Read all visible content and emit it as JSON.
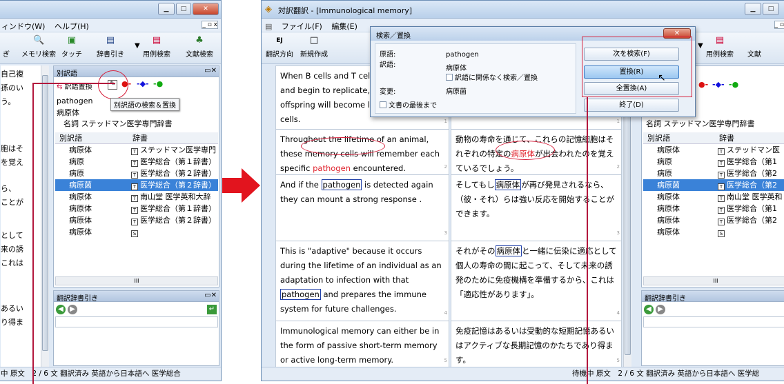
{
  "left_window": {
    "menu": [
      "ィンドウ(W)",
      "ヘルプ(H)"
    ],
    "toolbar": [
      "ぎ",
      "メモリ検索",
      "タッチ",
      "辞書引き",
      "用例検索",
      "文献検索"
    ],
    "left_text": [
      "自己複",
      "孫のい",
      "う。",
      "胞はそ",
      "を覚え",
      "ら、",
      "ことが",
      "として",
      "来の誘",
      "これは",
      "あるい",
      "り得ま"
    ],
    "alt_pane": {
      "title": "別訳語",
      "replace_btn": "訳語置換",
      "tooltip": "別訳語の検索＆置換",
      "source_word": "pathogen",
      "target_word": "病原体",
      "pos_line": "名詞 ステッドマン医学専門辞書",
      "headers": [
        "別訳語",
        "辞書"
      ],
      "rows": [
        {
          "term": "病原体",
          "dict": "ステッドマン医学専門"
        },
        {
          "term": "病原",
          "dict": "医学総合（第１辞書）"
        },
        {
          "term": "病原",
          "dict": "医学総合（第２辞書）"
        },
        {
          "term": "病原菌",
          "dict": "医学総合（第２辞書）",
          "selected": true
        },
        {
          "term": "病原体",
          "dict": "南山堂 医学英和大辞"
        },
        {
          "term": "病原体",
          "dict": "医学総合（第１辞書）"
        },
        {
          "term": "病原体",
          "dict": "医学総合（第２辞書）"
        },
        {
          "term": "病原体",
          "dict": ""
        }
      ],
      "scroll_label": "III"
    },
    "dict_pane_title": "翻訳辞書引き",
    "status": "中 原文　2 / 6 文 翻訳済み 英語から日本語へ 医学総合"
  },
  "main_window": {
    "title": "対訳翻訳 - [Immunological memory]",
    "menu": [
      "ファイル(F)",
      "編集(E)"
    ],
    "toolbar": [
      {
        "icon": "EJ",
        "label": "翻訳方向"
      },
      {
        "icon": "□",
        "label": "新規作成"
      }
    ],
    "toolbar_right": [
      "き",
      "用例検索",
      "文献"
    ],
    "english": [
      {
        "a": "When B cells and T cells",
        "b": "and begin to replicate,",
        "c": "offspring will become lo",
        "d": "cells."
      },
      {
        "lines": [
          "Throughout the lifetime of an animal,",
          "these memory cells will remember each"
        ],
        "pre": "specific ",
        "word": "pathogen",
        "post": " encountered."
      },
      {
        "pre": "And if the ",
        "word": "pathogen",
        "post": " is detected again",
        "line2": "they can mount a strong response ."
      },
      {
        "lines": [
          "This is \"adaptive\" because it occurs",
          "during the lifetime of an individual as an",
          "adaptation to infection with that"
        ],
        "word": "pathogen",
        "post": " and prepares the immune",
        "line5": "system for future challenges."
      },
      {
        "lines": [
          "Immunological memory can either be in",
          "the form of passive short-term memory",
          "or active long-term memory."
        ]
      }
    ],
    "japanese": [
      {
        "pre": "動物の寿命を通じて、これらの記憶細胞はそ",
        "l2pre": "れぞれの特定の",
        "word": "病原体",
        "l2post": "が出会われたのを覚え",
        "l3": "ているでしょう。"
      },
      {
        "pre": "そしてもし",
        "word": "病原体",
        "post": "が再び発見されるなら、",
        "l2": "（彼・それ）らは強い反応を開始することが",
        "l3": "できます。"
      },
      {
        "pre": "それがその",
        "word": "病原体",
        "post": "と一緒に伝染に適応として",
        "l2": "個人の寿命の間に起こって、そして未来の誘",
        "l3": "発のために免疫機構を準備するから、これは",
        "l4": "「適応性があります」。"
      },
      {
        "lines": [
          "免疫記憶はあるいは受動的な短期記憶あるい",
          "はアクティブな長期記憶のかたちであり得ま",
          "す。"
        ]
      }
    ],
    "seg_marks": [
      "1",
      "2",
      "3",
      "4",
      "5"
    ],
    "right_pane": {
      "pos_line": "名詞 ステッドマン医学専門辞書",
      "headers": [
        "別訳語",
        "辞書"
      ],
      "rows": [
        {
          "term": "病原体",
          "dict": "ステッドマン医"
        },
        {
          "term": "病原",
          "dict": "医学総合（第1"
        },
        {
          "term": "病原",
          "dict": "医学総合（第2"
        },
        {
          "term": "病原菌",
          "dict": "医学総合（第2",
          "selected": true
        },
        {
          "term": "病原体",
          "dict": "南山堂 医学英和"
        },
        {
          "term": "病原体",
          "dict": "医学総合（第1"
        },
        {
          "term": "病原体",
          "dict": "医学総合（第2"
        },
        {
          "term": "病原体",
          "dict": ""
        }
      ],
      "dict_title": "翻訳辞書引き",
      "scroll_label": "III"
    },
    "status": "待機中 原文　2 / 6 文 翻訳済み 英語から日本語へ 医学総"
  },
  "dialog": {
    "title": "検索／置換",
    "source_label": "原語:",
    "source_value": "pathogen",
    "target_label": "訳語:",
    "target_value": "病原体",
    "ignore_label": "訳語に関係なく検索／置換",
    "change_label": "変更:",
    "change_value": "病原菌",
    "to_end_label": "文書の最後まで",
    "buttons": [
      "次を検索(F)",
      "置換(R)",
      "全置換(A)",
      "終了(D)"
    ]
  },
  "colors": {
    "highlight": "#e0252f",
    "arrow": "#e2141e",
    "annotation": "#b3173d",
    "selection": "#3a82d8"
  }
}
